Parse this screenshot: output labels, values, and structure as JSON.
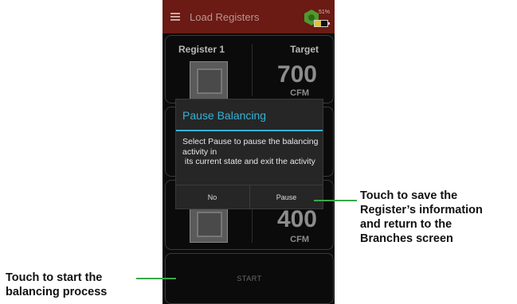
{
  "appbar": {
    "title": "Load Registers",
    "battery_percent": "51%",
    "battery_level": 0.51,
    "icons": [
      "menu-icon",
      "brand-logo-icon",
      "battery-icon"
    ]
  },
  "card1": {
    "register_label": "Register 1",
    "target_label": "Target",
    "value": "700",
    "unit": "CFM"
  },
  "card3": {
    "value": "400",
    "unit": "CFM"
  },
  "start_button": {
    "label": "START"
  },
  "dialog": {
    "title": "Pause Balancing",
    "message": "Select Pause to pause the balancing activity in\n its current state and exit the activity",
    "no_label": "No",
    "pause_label": "Pause"
  },
  "annotations": {
    "pause_callout": [
      "Touch to save the",
      "Register’s information",
      "and return to the",
      "Branches screen"
    ],
    "start_callout": [
      "Touch to start the",
      "balancing process"
    ]
  },
  "colors": {
    "appbar": "#6b1a14",
    "dialog_accent": "#34b3d6",
    "callout_line": "#3aa84a"
  }
}
